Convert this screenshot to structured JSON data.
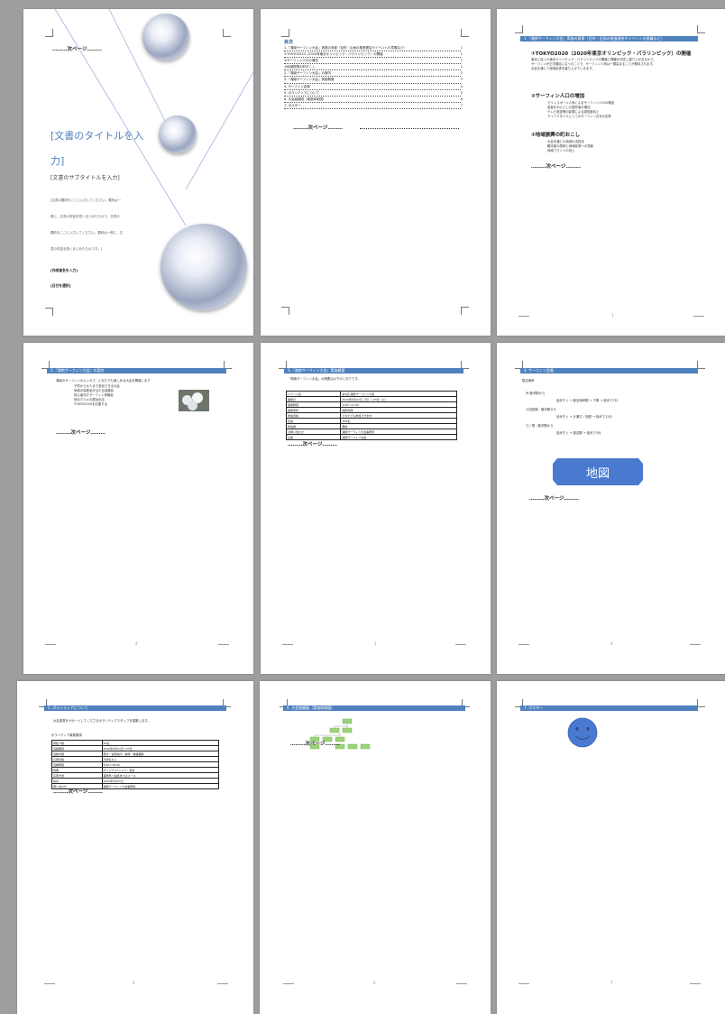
{
  "common": {
    "next_page": "………次ページ………"
  },
  "p1": {
    "title_line1": "[文書のタイトルを入",
    "title_line2": "力]",
    "subtitle": "[文書のサブタイトルを入力]",
    "abstract_lines": [
      "[文書の要約をここに入力してください。要約は一",
      "般に、文書の内容を短くまとめたもので、文書の",
      "要約をここに入力してください。要約は一般に、文",
      "書の内容を短くまとめたものです。]"
    ],
    "author": "[作成者名を入力]",
    "date": "[日付を選択]"
  },
  "p2": {
    "toc_heading": "目次",
    "toc_items": [
      "1.「湘南サーフィン大会」実施の背景（目的・企画の推進理由やイベントの意義など）",
      "①TOKYO2020（2020年東京オリンピック・パラリンピック）の開催",
      "②サーフィン人口の増加",
      "③地域振興の町おこし",
      "2.「湘南サーフィン大会」の案内",
      "3.「湘南サーフィン大会」実施概要",
      "4. サーフィン会場",
      "5. ボランティアについて",
      "6. 大会組織図（実施体制図）",
      "7. ポスター"
    ],
    "toc_pages": [
      "1",
      "1",
      "1",
      "1",
      "2",
      "3",
      "4",
      "5",
      "6",
      "7"
    ]
  },
  "p3": {
    "bar": "1.「湘南サーフィン大会」実施の背景（目的・企画の推進理由やイベントの意義など）",
    "s1": "①TOKYO2020（2020年東京オリンピック・パラリンピック）の開催",
    "s1_text": [
      "東京に迫った東京オリンピック・パラリンピックの開催と開催が決定し盛り上がるなかで、",
      "サーフィンが正式種目になったことで、サーフィン人気は一層高まることが期待されます。",
      "大会を通じて地域全体を盛り上げていきます。"
    ],
    "s2": "②サーフィン人口の増加",
    "s2_items": [
      "マリンスポーツ人気によるサーフィン人口の増加",
      "若者を中心とした愛好者の増加",
      "テレビ放送等の影響による認知度向上",
      "ライフスタイルとしてのサーフィン文化の定着"
    ],
    "s3": "③地域振興の町おこし",
    "s3_items": [
      "大会を通じた地域の活性化",
      "観光客の誘致と地域経済への貢献",
      "地域ブランドの向上"
    ]
  },
  "p4": {
    "bar": "2.「湘南サーフィン大会」の案内",
    "intro": "湘南のサーフィンのメッカで、どなたでも楽しめる大会を開催します",
    "items": [
      "子供から大人まで参加できる大会",
      "地域の特産品が当たる抽選会",
      "初心者向けサーフィン体験会",
      "地元グルメの屋台出店",
      "TOKYO2020を応援する"
    ]
  },
  "p5": {
    "bar": "3.「湘南サーフィン大会」実施概要",
    "intro": "「湘南サーフィン大会」の概要は以下のとおりです。",
    "rows": [
      [
        "イベント名",
        "第1回 湘南サーフィン大会"
      ],
      [
        "開催日",
        "2020年6月22日（月）～23日（火）"
      ],
      [
        "開催時間",
        "9:00～17:00"
      ],
      [
        "開催場所",
        "湘南海岸"
      ],
      [
        "参加資格",
        "どなたでも参加できます"
      ],
      [
        "定員",
        "200名"
      ],
      [
        "参加費",
        "無料"
      ],
      [
        "お問い合わせ",
        "湘南サーフィン大会事務局"
      ],
      [
        "主催",
        "湘南サーフィン協会"
      ]
    ]
  },
  "p6": {
    "bar": "4. サーフィン会場",
    "l0": "鵠沼海岸",
    "l1": "JR 藤沢駅から",
    "l2": "徒歩すぐ → 鵠沼海岸駅 → 下車 → 徒歩で7分",
    "l3": "小田急線・藤沢駅から",
    "l4": "徒歩すぐ → 片瀬江ノ島駅 → 徒歩で12分",
    "l5": "江ノ電・藤沢駅から",
    "l6": "徒歩すぐ → 鵠沼駅 → 徒歩で3分",
    "map_label": "地図"
  },
  "p7": {
    "bar": "5. ボランティアについて",
    "intro": "大会運営をサポートしてくださるボランティアスタッフを募集します。",
    "list_title": "ボランティア募集要項",
    "rows": [
      [
        "募集人数",
        "50名"
      ],
      [
        "活動期間",
        "2020年6月22日～23日"
      ],
      [
        "活動内容",
        "受付・会場案内・誘導・救護補助"
      ],
      [
        "応募資格",
        "高校生以上"
      ],
      [
        "活動時間",
        "8:00～18:00"
      ],
      [
        "特典",
        "オリジナルTシャツ・昼食"
      ],
      [
        "応募方法",
        "事務局へ電話またはメール"
      ],
      [
        "締切",
        "2020年5月31日"
      ],
      [
        "問い合わせ",
        "湘南サーフィン大会事務局"
      ]
    ]
  },
  "p8": {
    "bar": "6. 大会組織図（実施体制図）"
  },
  "p9": {
    "bar": "7. ポスター"
  },
  "footers": [
    "1",
    "2",
    "3",
    "4",
    "5",
    "6",
    "7"
  ]
}
